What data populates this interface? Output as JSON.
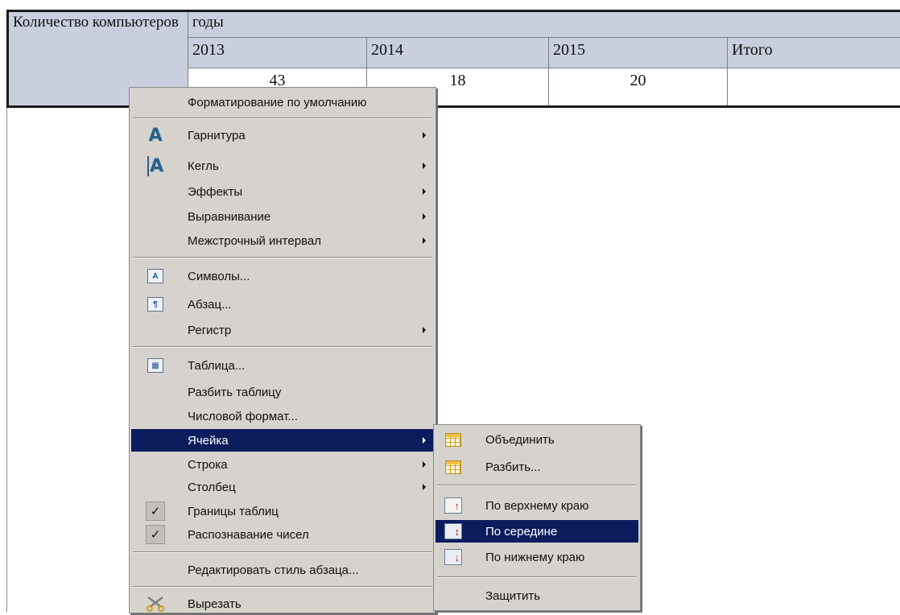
{
  "table": {
    "row_header": "Количество компьютеров",
    "group_header": "годы",
    "years": [
      "2013",
      "2014",
      "2015",
      "Итого"
    ],
    "values": [
      "43",
      "18",
      "20",
      ""
    ]
  },
  "context_menu": {
    "items": [
      {
        "label": "Форматирование по умолчанию",
        "submenu": false
      },
      {
        "label": "Гарнитура",
        "submenu": true,
        "icon": "font-name-icon"
      },
      {
        "label": "Кегль",
        "submenu": true,
        "icon": "font-size-icon"
      },
      {
        "label": "Эффекты",
        "submenu": true
      },
      {
        "label": "Выравнивание",
        "submenu": true
      },
      {
        "label": "Межстрочный интервал",
        "submenu": true
      },
      {
        "label": "Символы...",
        "submenu": false,
        "icon": "character-icon"
      },
      {
        "label": "Абзац...",
        "submenu": false,
        "icon": "paragraph-icon"
      },
      {
        "label": "Регистр",
        "submenu": true
      },
      {
        "label": "Таблица...",
        "submenu": false,
        "icon": "table-props-icon"
      },
      {
        "label": "Разбить таблицу",
        "submenu": false
      },
      {
        "label": "Числовой формат...",
        "submenu": false
      },
      {
        "label": "Ячейка",
        "submenu": true,
        "highlighted": true
      },
      {
        "label": "Строка",
        "submenu": true
      },
      {
        "label": "Столбец",
        "submenu": true
      },
      {
        "label": "Границы таблиц",
        "submenu": false,
        "checked": true
      },
      {
        "label": "Распознавание чисел",
        "submenu": false,
        "checked": true
      },
      {
        "label": "Редактировать стиль абзаца...",
        "submenu": false
      },
      {
        "label": "Вырезать",
        "submenu": false,
        "icon": "scissors-icon"
      }
    ]
  },
  "cell_submenu": {
    "items": [
      {
        "label": "Объединить",
        "icon": "merge-cells-icon"
      },
      {
        "label": "Разбить...",
        "icon": "split-cells-icon"
      },
      {
        "label": "По верхнему краю",
        "icon": "align-top-icon"
      },
      {
        "label": "По середине",
        "icon": "align-middle-icon",
        "highlighted": true
      },
      {
        "label": "По нижнему краю",
        "icon": "align-bottom-icon"
      },
      {
        "label": "Защитить"
      }
    ]
  },
  "colors": {
    "menu_bg": "#d6d3ce",
    "highlight": "#0c1d5e",
    "table_header": "#c9cfdf"
  }
}
